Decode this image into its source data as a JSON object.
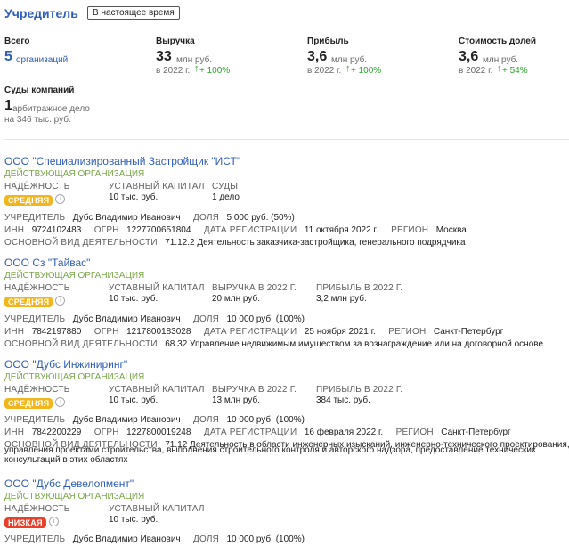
{
  "header": {
    "title": "Учредитель",
    "button": "В настоящее время"
  },
  "stats": [
    {
      "label": "Всего",
      "value": "5",
      "unit": "организаций",
      "sub": "",
      "change": ""
    },
    {
      "label": "Выручка",
      "value": "33",
      "unit": "млн руб.",
      "sub": "в 2022 г.",
      "change": "+ 100%"
    },
    {
      "label": "Прибыль",
      "value": "3,6",
      "unit": "млн руб.",
      "sub": "в 2022 г.",
      "change": "+ 100%"
    },
    {
      "label": "Стоимость долей",
      "value": "3,6",
      "unit": "млн руб.",
      "sub": "в 2022 г.",
      "change": "+ 54%"
    }
  ],
  "courts": {
    "label": "Суды компаний",
    "value": "1",
    "unit": "арбитражное дело",
    "sub": "на 346 тыс. руб."
  },
  "labels": {
    "reliability": "НАДЁЖНОСТЬ",
    "capital": "УСТАВНЫЙ КАПИТАЛ",
    "courts": "СУДЫ",
    "revenue": "ВЫРУЧКА В 2022 Г.",
    "profit": "ПРИБЫЛЬ В 2022 Г.",
    "founder": "УЧРЕДИТЕЛЬ",
    "share": "ДОЛЯ",
    "inn": "ИНН",
    "ogrn": "ОГРН",
    "regdate": "ДАТА РЕГИСТРАЦИИ",
    "region": "РЕГИОН",
    "activity": "ОСНОВНОЙ ВИД ДЕЯТЕЛЬНОСТИ",
    "info": "i"
  },
  "orgs": [
    {
      "name": "ООО \"Специализированный Застройщик \"ИСТ\"",
      "status": "ДЕЙСТВУЮЩАЯ ОРГАНИЗАЦИЯ",
      "reliability": "СРЕДНЯЯ",
      "capital": "10 тыс. руб.",
      "courts": "1 дело",
      "founder": "Дубс Владимир Иванович",
      "share": "5 000 руб. (50%)",
      "inn": "9724102483",
      "ogrn": "1227700651804",
      "regdate": "11 октября 2022 г.",
      "region": "Москва",
      "activity": "71.12.2 Деятельность заказчика-застройщика, генерального подрядчика"
    },
    {
      "name": "ООО Сз \"Тайвас\"",
      "status": "ДЕЙСТВУЮЩАЯ ОРГАНИЗАЦИЯ",
      "reliability": "СРЕДНЯЯ",
      "capital": "10 тыс. руб.",
      "revenue": "20 млн руб.",
      "profit": "3,2 млн руб.",
      "founder": "Дубс Владимир Иванович",
      "share": "10 000 руб. (100%)",
      "inn": "7842197880",
      "ogrn": "1217800183028",
      "regdate": "25 ноября 2021 г.",
      "region": "Санкт-Петербург",
      "activity": "68.32 Управление недвижимым имуществом за вознаграждение или на договорной основе"
    },
    {
      "name": "ООО \"Дубс Инжиниринг\"",
      "status": "ДЕЙСТВУЮЩАЯ ОРГАНИЗАЦИЯ",
      "reliability": "СРЕДНЯЯ",
      "capital": "10 тыс. руб.",
      "revenue": "13 млн руб.",
      "profit": "384 тыс. руб.",
      "founder": "Дубс Владимир Иванович",
      "share": "10 000 руб. (100%)",
      "inn": "7842200229",
      "ogrn": "1227800019248",
      "regdate": "16 февраля 2022 г.",
      "region": "Санкт-Петербург",
      "activity_l1": "71.12 Деятельность в области инженерных изысканий, инженерно-технического проектирования,",
      "activity_l2": "управления проектами строительства, выполнения строительного контроля и авторского надзора, предоставление технических",
      "activity_l3": "консультаций в этих областях"
    },
    {
      "name": "ООО \"Дубс Девелопмент\"",
      "status": "ДЕЙСТВУЮЩАЯ ОРГАНИЗАЦИЯ",
      "reliability": "НИЗКАЯ",
      "capital": "10 тыс. руб.",
      "founder": "Дубс Владимир Иванович",
      "share": "10 000 руб. (100%)"
    }
  ]
}
